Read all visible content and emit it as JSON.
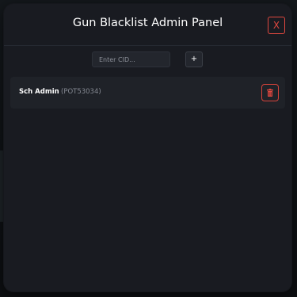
{
  "panel": {
    "title": "Gun Blacklist Admin Panel",
    "close_label": "X"
  },
  "add_form": {
    "cid_placeholder": "Enter CID...",
    "cid_value": "",
    "add_label": "+"
  },
  "blacklist": [
    {
      "name": "Sch Admin",
      "id": "(POT53034)"
    }
  ],
  "colors": {
    "panel_bg": "#191b21",
    "accent_danger": "#e0483f",
    "text_primary": "#ffffff",
    "text_muted": "#868a93"
  },
  "icons": {
    "delete": "trash-icon"
  }
}
